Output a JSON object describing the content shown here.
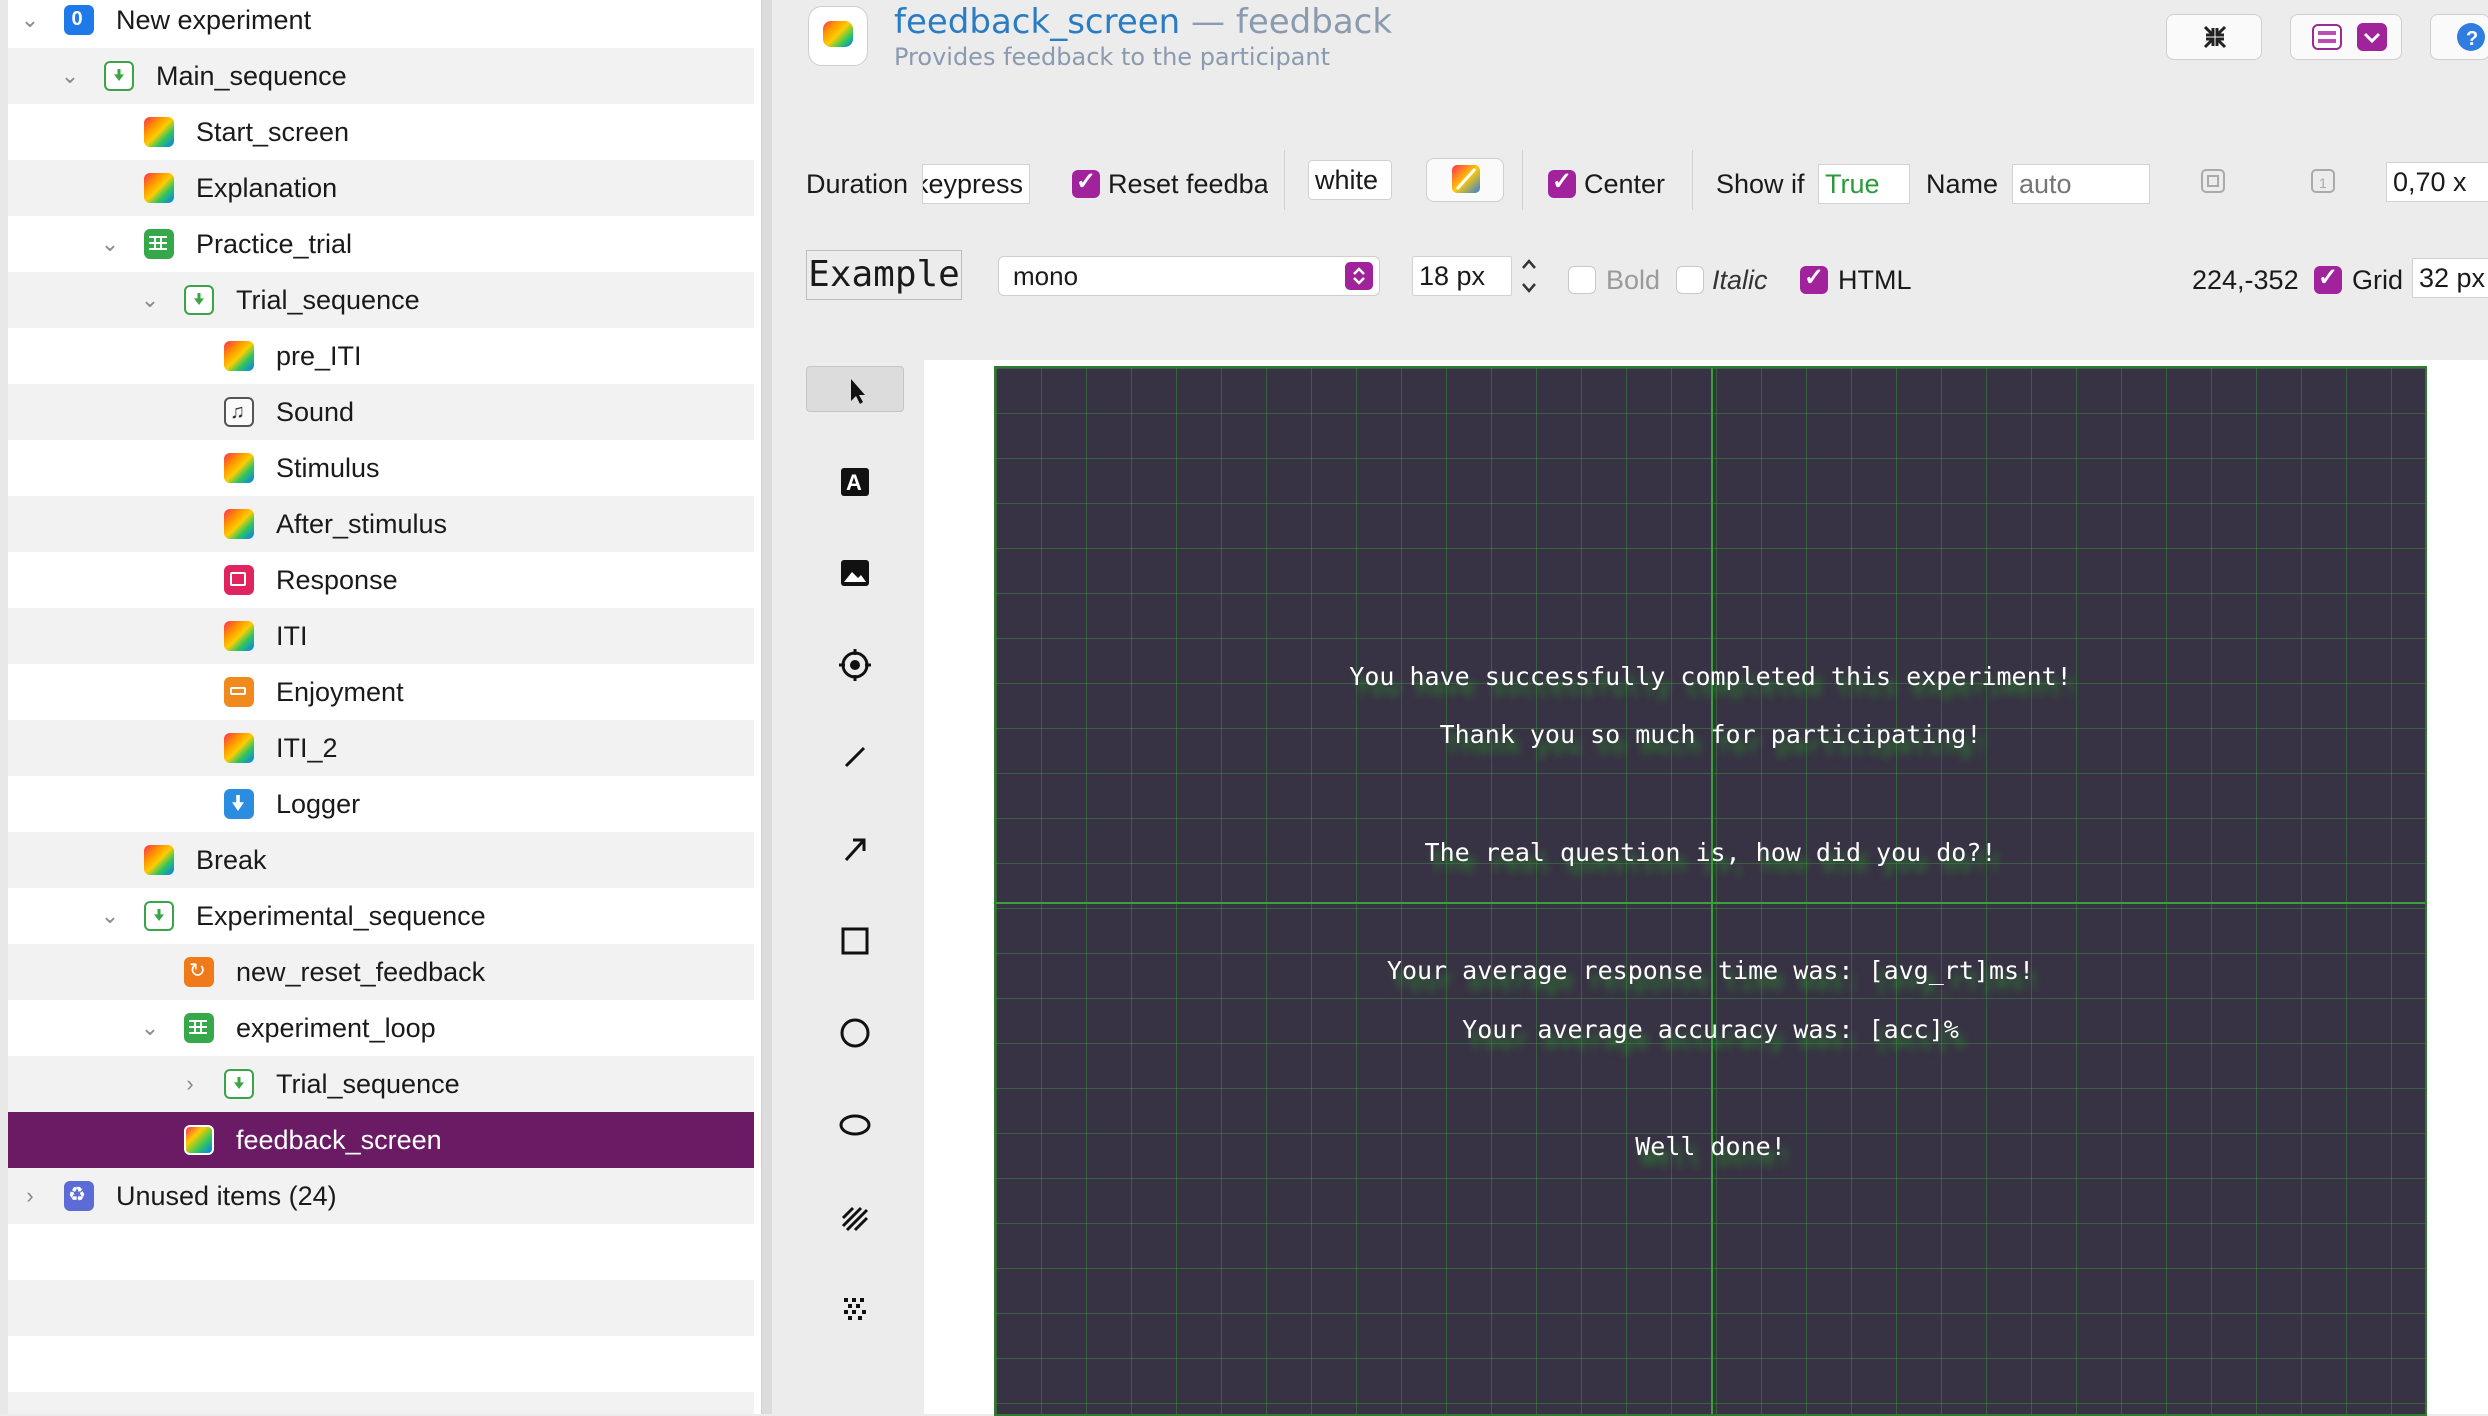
{
  "tree": {
    "items": [
      {
        "label": "New experiment",
        "icon": "experiment-icon",
        "chev": "⌄"
      },
      {
        "label": "Main_sequence",
        "icon": "sequence-icon",
        "chev": "⌄"
      },
      {
        "label": "Start_screen",
        "icon": "sketchpad-icon",
        "chev": ""
      },
      {
        "label": "Explanation",
        "icon": "sketchpad-icon",
        "chev": ""
      },
      {
        "label": "Practice_trial",
        "icon": "loop-icon",
        "chev": "⌄"
      },
      {
        "label": "Trial_sequence",
        "icon": "sequence-icon",
        "chev": "⌄"
      },
      {
        "label": "pre_ITI",
        "icon": "sketchpad-icon",
        "chev": ""
      },
      {
        "label": "Sound",
        "icon": "sampler-icon",
        "chev": ""
      },
      {
        "label": "Stimulus",
        "icon": "sketchpad-icon",
        "chev": ""
      },
      {
        "label": "After_stimulus",
        "icon": "sketchpad-icon",
        "chev": ""
      },
      {
        "label": "Response",
        "icon": "keyboard-response-icon",
        "chev": ""
      },
      {
        "label": "ITI",
        "icon": "sketchpad-icon",
        "chev": ""
      },
      {
        "label": "Enjoyment",
        "icon": "likert-icon",
        "chev": ""
      },
      {
        "label": "ITI_2",
        "icon": "sketchpad-icon",
        "chev": ""
      },
      {
        "label": "Logger",
        "icon": "logger-icon",
        "chev": ""
      },
      {
        "label": "Break",
        "icon": "sketchpad-icon",
        "chev": ""
      },
      {
        "label": "Experimental_sequence",
        "icon": "sequence-icon",
        "chev": "⌄"
      },
      {
        "label": "new_reset_feedback",
        "icon": "reset-feedback-icon",
        "chev": ""
      },
      {
        "label": "experiment_loop",
        "icon": "loop-icon",
        "chev": "⌄"
      },
      {
        "label": "Trial_sequence",
        "icon": "sequence-icon",
        "chev": "›"
      },
      {
        "label": "feedback_screen",
        "icon": "feedback-icon",
        "chev": ""
      },
      {
        "label": "Unused items (24)",
        "icon": "unused-items-icon",
        "chev": "›"
      }
    ]
  },
  "header": {
    "item_name": "feedback_screen",
    "separator": "—",
    "item_type": "feedback",
    "description": "Provides feedback to the participant"
  },
  "toolbar1": {
    "duration_label": "Duration",
    "duration_value": "keypress",
    "reset_label": "Reset feedba",
    "color_value": "white",
    "center_label": "Center",
    "show_if_label": "Show if",
    "show_if_value": "True",
    "name_label": "Name",
    "name_placeholder": "auto",
    "zoom_value": "0,70 x"
  },
  "toolbar2": {
    "font_preview": "Example",
    "font_family": "mono",
    "font_size": "18 px",
    "bold_label": "Bold",
    "italic_label": "Italic",
    "html_label": "HTML",
    "coords": "224,-352",
    "grid_label": "Grid",
    "grid_size": "32 px"
  },
  "canvas": {
    "lines": [
      "You have successfully completed this experiment!",
      "Thank you so much for participating!",
      "The real question is, how did you do?!",
      "Your average response time was: [avg_rt]ms!",
      "Your average accuracy was: [acc]%",
      "Well done!"
    ]
  },
  "colors": {
    "selection": "#6a1b64",
    "accent_checkbox": "#a1239c",
    "canvas_bg": "#383344",
    "grid_line": "#3aa03a",
    "title_blue": "#2a7dc2"
  }
}
